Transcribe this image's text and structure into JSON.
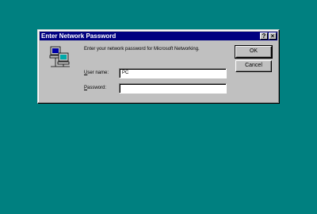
{
  "dialog": {
    "title": "Enter Network Password",
    "help_glyph": "?",
    "close_glyph": "×",
    "prompt": "Enter your network password for Microsoft Networking.",
    "username_label_mnemonic": "U",
    "username_label_rest": "ser name:",
    "username_value": "PC",
    "password_label_mnemonic": "P",
    "password_label_rest": "assword:",
    "password_value": "",
    "ok_label": "OK",
    "cancel_label": "Cancel"
  },
  "colors": {
    "desktop": "#008080",
    "titlebar": "#000080",
    "face": "#c0c0c0"
  }
}
